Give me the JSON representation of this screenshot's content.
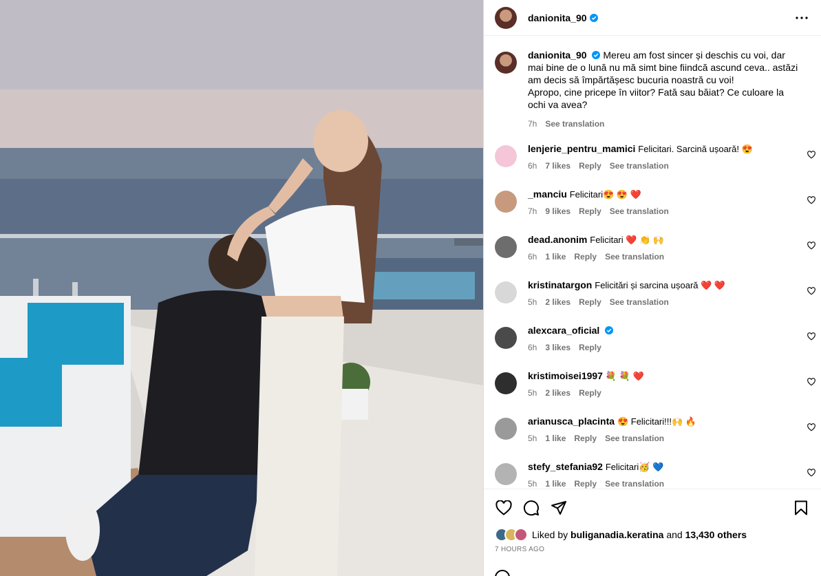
{
  "post": {
    "author": "danionita_90",
    "more_label": "More options",
    "caption": {
      "text": "Mereu am fost sincer și deschis cu voi, dar mai bine de o lună nu mă simt bine fiindcă ascund ceva.. astăzi am decis să împărtășesc bucuria noastră cu voi!",
      "text2": "Apropo, cine pricepe în viitor? Fată sau băiat? Ce culoare la ochi va avea?",
      "time": "7h",
      "see_translation": "See translation"
    },
    "comments": [
      {
        "user": "lenjerie_pentru_mamici",
        "text": "Felicitari. Sarcină ușoară! 😍",
        "time": "6h",
        "likes": "7 likes",
        "reply": "Reply",
        "translation": "See translation",
        "avatar_color": "#f4c6d7"
      },
      {
        "user": "_manciu",
        "text": "Felicitari😍 😍 ❤️",
        "time": "7h",
        "likes": "9 likes",
        "reply": "Reply",
        "translation": "See translation",
        "avatar_color": "#c79a7e"
      },
      {
        "user": "dead.anonim",
        "text": "Felicitari ❤️ 👏 🙌",
        "time": "6h",
        "likes": "1 like",
        "reply": "Reply",
        "translation": "See translation",
        "avatar_color": "#6d6d6d"
      },
      {
        "user": "kristinatargon",
        "text": "Felicitări și sarcina ușoară ❤️ ❤️",
        "time": "5h",
        "likes": "2 likes",
        "reply": "Reply",
        "translation": "See translation",
        "avatar_color": "#d8d8d8"
      },
      {
        "user": "alexcara_oficial",
        "text": "",
        "time": "6h",
        "likes": "3 likes",
        "reply": "Reply",
        "translation": "",
        "avatar_color": "#4a4a4a",
        "verified": true
      },
      {
        "user": "kristimoisei1997",
        "text": "💐 💐 ❤️",
        "time": "5h",
        "likes": "2 likes",
        "reply": "Reply",
        "translation": "",
        "avatar_color": "#2e2e2e"
      },
      {
        "user": "arianusca_placinta",
        "text": "😍 Felicitari!!!🙌 🔥",
        "time": "5h",
        "likes": "1 like",
        "reply": "Reply",
        "translation": "See translation",
        "avatar_color": "#9a9a9a"
      },
      {
        "user": "stefy_stefania92",
        "text": "Felicitari🥳 💙",
        "time": "5h",
        "likes": "1 like",
        "reply": "Reply",
        "translation": "See translation",
        "avatar_color": "#b3b3b3"
      }
    ],
    "liked_by": {
      "prefix": "Liked by",
      "user": "buliganadia.keratina",
      "middle": "and",
      "others": "13,430 others"
    },
    "timestamp": "7 HOURS AGO"
  },
  "icons": {
    "like": "heart-icon",
    "comment": "comment-icon",
    "share": "share-icon",
    "save": "bookmark-icon",
    "more": "more-horizontal-icon",
    "verified": "verified-badge-icon"
  },
  "colors": {
    "verified": "#0095f6",
    "meta_gray": "#737373",
    "border": "#dbdbdb"
  }
}
